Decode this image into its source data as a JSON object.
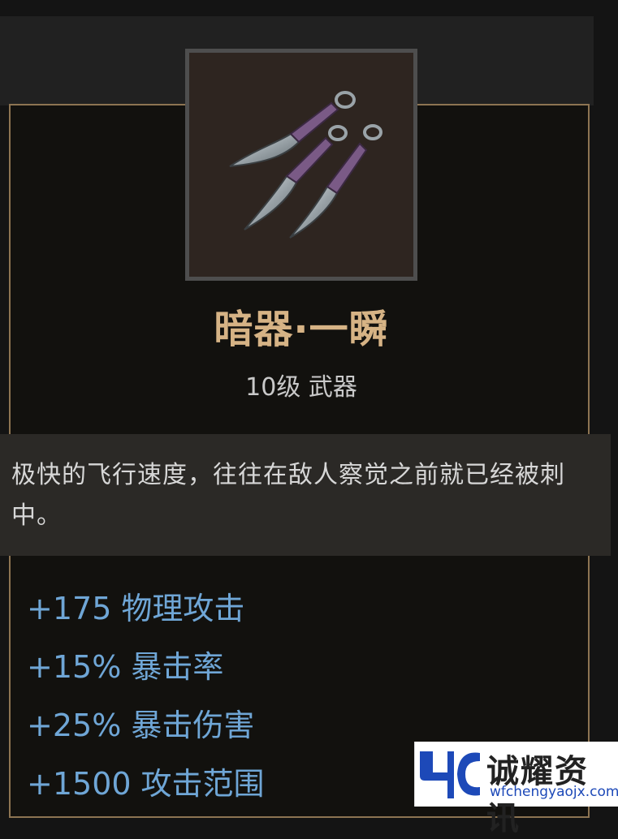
{
  "item": {
    "icon": "throwing-knives-icon",
    "name": "暗器·一瞬",
    "meta": "10级 武器",
    "description": "极快的飞行速度，往往在敌人察觉之前就已经被刺中。"
  },
  "stats": [
    {
      "value": "+175",
      "label": "物理攻击"
    },
    {
      "value": "+15%",
      "label": "暴击率"
    },
    {
      "value": "+25%",
      "label": "暴击伤害"
    },
    {
      "value": "+1500",
      "label": "攻击范围"
    }
  ],
  "watermark": {
    "name": "诚耀资讯",
    "url": "wfchengyaojx.com"
  },
  "colors": {
    "title": "#d6b385",
    "stat": "#6fa6d6",
    "border": "#8d7452",
    "watermark_blue": "#1d49b8"
  }
}
